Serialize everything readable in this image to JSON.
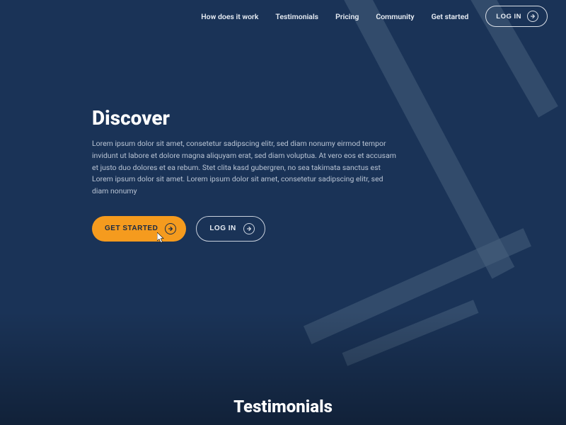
{
  "nav": {
    "items": [
      {
        "label": "How does it work"
      },
      {
        "label": "Testimonials"
      },
      {
        "label": "Pricing"
      },
      {
        "label": "Community"
      },
      {
        "label": "Get started"
      }
    ],
    "login_label": "LOG IN"
  },
  "hero": {
    "title": "Discover",
    "body": "Lorem ipsum dolor sit amet, consetetur sadipscing elitr, sed diam nonumy eirmod tempor invidunt ut labore et dolore magna aliquyam erat, sed diam voluptua. At vero eos et accusam et justo duo dolores et ea rebum. Stet clita kasd gubergren, no sea takimata sanctus est Lorem ipsum dolor sit amet. Lorem ipsum dolor sit amet, consetetur sadipscing elitr, sed diam nonumy",
    "cta_label": "GET STARTED",
    "login_label": "LOG IN"
  },
  "sections": {
    "testimonials_heading": "Testimonials"
  },
  "colors": {
    "background": "#1a3357",
    "accent": "#f59b1e",
    "text_muted": "#b9c4d4"
  }
}
